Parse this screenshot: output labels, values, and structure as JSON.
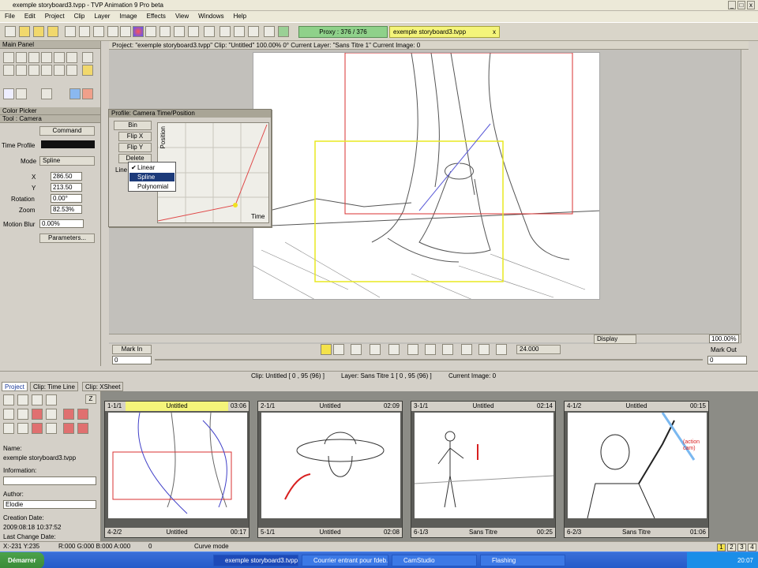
{
  "window": {
    "title": "exemple storyboard3.tvpp - TVP Animation 9 Pro beta",
    "controls": [
      "_",
      "□",
      "x"
    ]
  },
  "menu": [
    "File",
    "Edit",
    "Project",
    "Clip",
    "Layer",
    "Image",
    "Effects",
    "View",
    "Windows",
    "Help"
  ],
  "toolbar": {
    "proxy": "Proxy : 376 / 376",
    "file_tab": "exemple storyboard3.tvpp",
    "file_tab_close": "x"
  },
  "main_panel": {
    "title": "Main Panel",
    "color_picker": "Color Picker",
    "tool": "Tool : Camera"
  },
  "camera": {
    "command": "Command",
    "time_profile": "Time Profile",
    "mode_label": "Mode",
    "mode_value": "Spline",
    "x_label": "X",
    "x_value": "286.50",
    "y_label": "Y",
    "y_value": "213.50",
    "rotation_label": "Rotation",
    "rotation_value": "0.00°",
    "zoom_label": "Zoom",
    "zoom_value": "82.53%",
    "motion_blur_label": "Motion Blur",
    "motion_blur_value": "0.00%",
    "parameters_btn": "Parameters..."
  },
  "viewport": {
    "header": "Project: \"exemple storyboard3.tvpp\"  Clip: \"Untitled\"  100.00%  0°  Current Layer: \"Sans Titre 1\"  Current Image: 0"
  },
  "profile": {
    "title": "Profile: Camera Time/Position",
    "bin": "Bin",
    "flip_x": "Flip X",
    "flip_y": "Flip Y",
    "delete": "Delete",
    "line_label": "Line",
    "axis_y": "Position",
    "axis_x": "Time",
    "options": [
      "Linear",
      "Spline",
      "Polynomial"
    ],
    "selected": "Spline"
  },
  "transport": {
    "display": "Display",
    "zoom": "100.00%",
    "fps": "24.000",
    "mark_in": "Mark In",
    "mark_out": "Mark Out",
    "in_value": "0",
    "out_value": "0"
  },
  "clip_status": {
    "clip": "Clip: Untitled [ 0 , 95  (96) ]",
    "layer": "Layer: Sans Titre 1 [ 0 , 95  (96) ]",
    "image": "Current Image: 0"
  },
  "tabs": [
    "Project",
    "Clip: Time Line",
    "Clip: XSheet"
  ],
  "project_panel": {
    "z_btn": "Z",
    "name_label": "Name:",
    "name_value": "exemple storyboard3.tvpp",
    "info_label": "Information:",
    "info_value": "",
    "author_label": "Author:",
    "author_value": "Elodie",
    "creation_label": "Creation Date:",
    "creation_value": "2009:08:18 10:37:52",
    "last_change_label": "Last Change Date:"
  },
  "storyboard": [
    {
      "num": "1-1/1",
      "title": "Untitled",
      "dur": "03:06",
      "highlight": true
    },
    {
      "num": "2-1/1",
      "title": "Untitled",
      "dur": "02:09",
      "highlight": false
    },
    {
      "num": "3-1/1",
      "title": "Untitled",
      "dur": "02:14",
      "highlight": false
    },
    {
      "num": "4-1/2",
      "title": "Untitled",
      "dur": "00:15",
      "highlight": false
    }
  ],
  "storyboard_next": [
    {
      "num": "4-2/2",
      "title": "Untitled",
      "dur": "00:17"
    },
    {
      "num": "5-1/1",
      "title": "Untitled",
      "dur": "02:08"
    },
    {
      "num": "6-1/3",
      "title": "Sans Titre",
      "dur": "00:25"
    },
    {
      "num": "6-2/3",
      "title": "Sans Titre",
      "dur": "01:06"
    }
  ],
  "card4_note": "(action cam)",
  "status": {
    "coords": "X:-231  Y:235",
    "rgba": "R:000 G:000 B:000 A:000",
    "value": "0",
    "mode": "Curve mode",
    "pages": [
      "1",
      "2",
      "3",
      "4"
    ]
  },
  "taskbar": {
    "start": "Démarrer",
    "tasks": [
      "exemple storyboard3.tvpp",
      "Courrier entrant pour fdeb...",
      "CamStudio",
      "Flashing"
    ],
    "clock": "20:07"
  },
  "colors": {
    "accent_yellow": "#f4f47a",
    "proxy_green": "#8fd18a",
    "camera_frame": "#e8e820",
    "safe_frame": "#d83030"
  }
}
